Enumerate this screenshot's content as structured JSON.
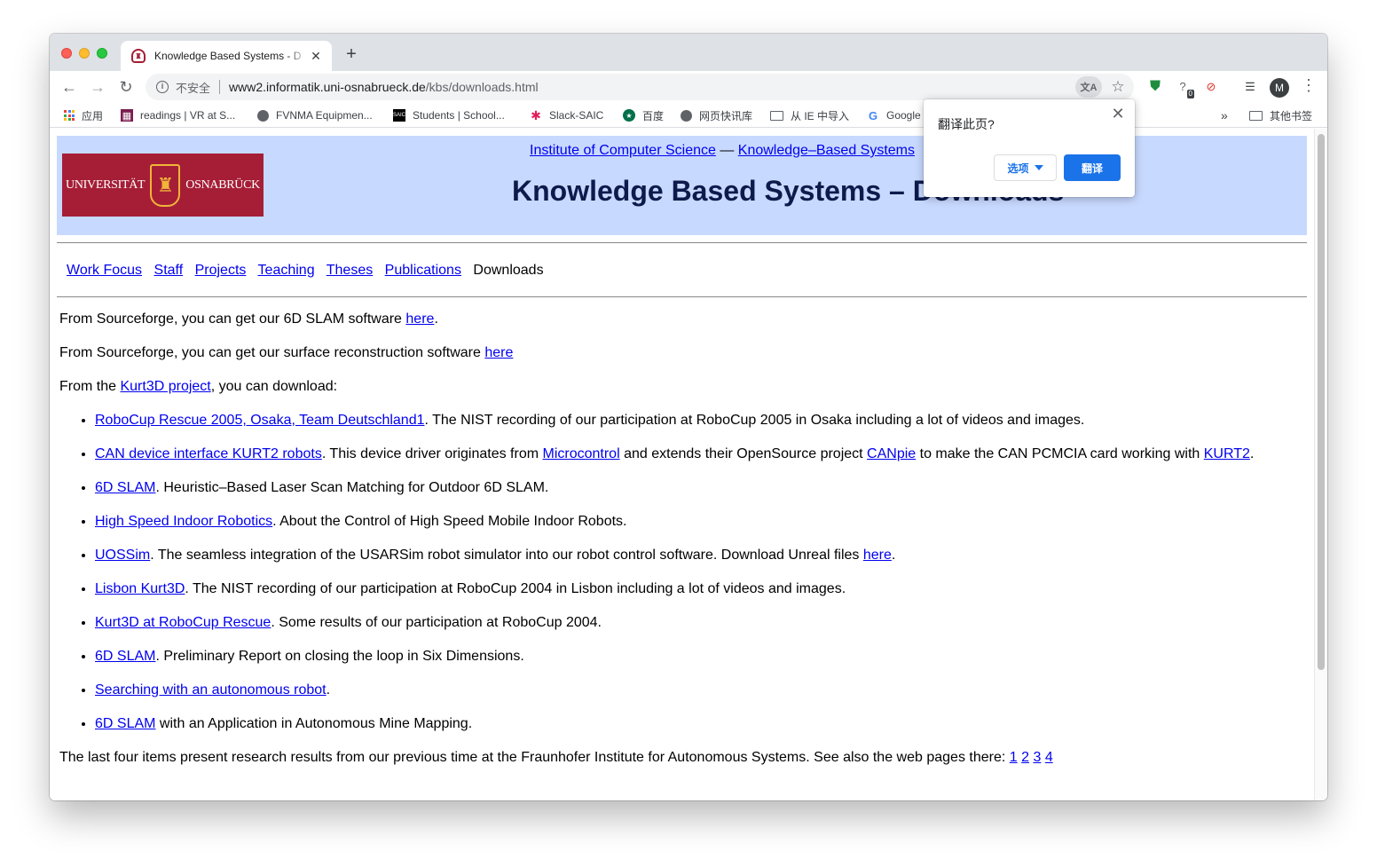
{
  "browser": {
    "tab_title": "Knowledge Based Systems - D",
    "new_tab_label": "+",
    "omnibox": {
      "security_label": "不安全",
      "url_host": "www2.informatik.uni-osnabrueck.de",
      "url_path": "/kbs/downloads.html"
    },
    "avatar_initial": "M",
    "extension_badge": "0"
  },
  "bookmarks": {
    "items": [
      {
        "label": "应用",
        "icon": "apps-grid-icon"
      },
      {
        "label": "readings | VR at S...",
        "icon": "favicon"
      },
      {
        "label": "FVNMA Equipmen...",
        "icon": "globe-icon"
      },
      {
        "label": "Students | School...",
        "icon": "saic-icon"
      },
      {
        "label": "Slack-SAIC",
        "icon": "slack-icon"
      },
      {
        "label": "百度",
        "icon": "starbucks-icon"
      },
      {
        "label": "网页快讯库",
        "icon": "globe-icon"
      },
      {
        "label": "从 IE 中导入",
        "icon": "folder-icon"
      },
      {
        "label": "Google",
        "icon": "google-icon"
      }
    ],
    "overflow": "»",
    "other_bookmarks": "其他书签"
  },
  "translate_popup": {
    "title": "翻译此页?",
    "options_label": "选项",
    "translate_label": "翻译"
  },
  "page": {
    "logo": {
      "left": "UNIVERSITÄT",
      "right": "OSNABRÜCK"
    },
    "header_link_1": "Institute of Computer Science",
    "header_sep": " — ",
    "header_link_2": "Knowledge–Based Systems",
    "title": "Knowledge Based Systems – Downloads",
    "nav": {
      "work_focus": "Work Focus",
      "staff": "Staff",
      "projects": "Projects",
      "teaching": "Teaching",
      "theses": "Theses",
      "publications": "Publications",
      "downloads": "Downloads"
    },
    "p1": {
      "before": "From Sourceforge, you can get our 6D SLAM software ",
      "link": "here",
      "after": "."
    },
    "p2": {
      "before": "From Sourceforge, you can get our surface reconstruction software ",
      "link": "here"
    },
    "p3": {
      "before": "From the ",
      "link": "Kurt3D project",
      "after": ", you can download:"
    },
    "items": [
      {
        "link": "RoboCup Rescue 2005, Osaka, Team Deutschland1",
        "text": ". The NIST recording of our participation at RoboCup 2005 in Osaka including a lot of videos and images."
      },
      {
        "link": "CAN device interface KURT2 robots",
        "text_a": ". This device driver originates from ",
        "link_b": "Microcontrol",
        "text_b": " and extends their OpenSource project ",
        "link_c": "CANpie",
        "text_c": " to make the CAN PCMCIA card working with ",
        "link_d": "KURT2",
        "text_d": "."
      },
      {
        "link": "6D SLAM",
        "text": ". Heuristic–Based Laser Scan Matching for Outdoor 6D SLAM."
      },
      {
        "link": "High Speed Indoor Robotics",
        "text": ". About the Control of High Speed Mobile Indoor Robots."
      },
      {
        "link": "UOSSim",
        "text": ". The seamless integration of the USARSim robot simulator into our robot control software. Download Unreal files ",
        "link_b": "here",
        "text_b": "."
      },
      {
        "link": "Lisbon Kurt3D",
        "text": ". The NIST recording of our participation at RoboCup 2004 in Lisbon including a lot of videos and images."
      },
      {
        "link": "Kurt3D at RoboCup Rescue",
        "text": ". Some results of our participation at RoboCup 2004."
      },
      {
        "link": "6D SLAM",
        "text": ". Preliminary Report on closing the loop in Six Dimensions."
      },
      {
        "link": "Searching with an autonomous robot",
        "text": "."
      },
      {
        "link": "6D SLAM",
        "text": " with an Application in Autonomous Mine Mapping."
      }
    ],
    "footer": {
      "text": "The last four items present research results from our previous time at the Fraunhofer Institute for Autonomous Systems. See also the web pages there: ",
      "links": [
        "1",
        "2",
        "3",
        "4"
      ]
    }
  },
  "colors": {
    "header_bg": "#c8d9ff",
    "logo_bg": "#a51e36",
    "link": "#0000ee",
    "title": "#0d1b4c",
    "translate_button": "#1a73e8"
  }
}
